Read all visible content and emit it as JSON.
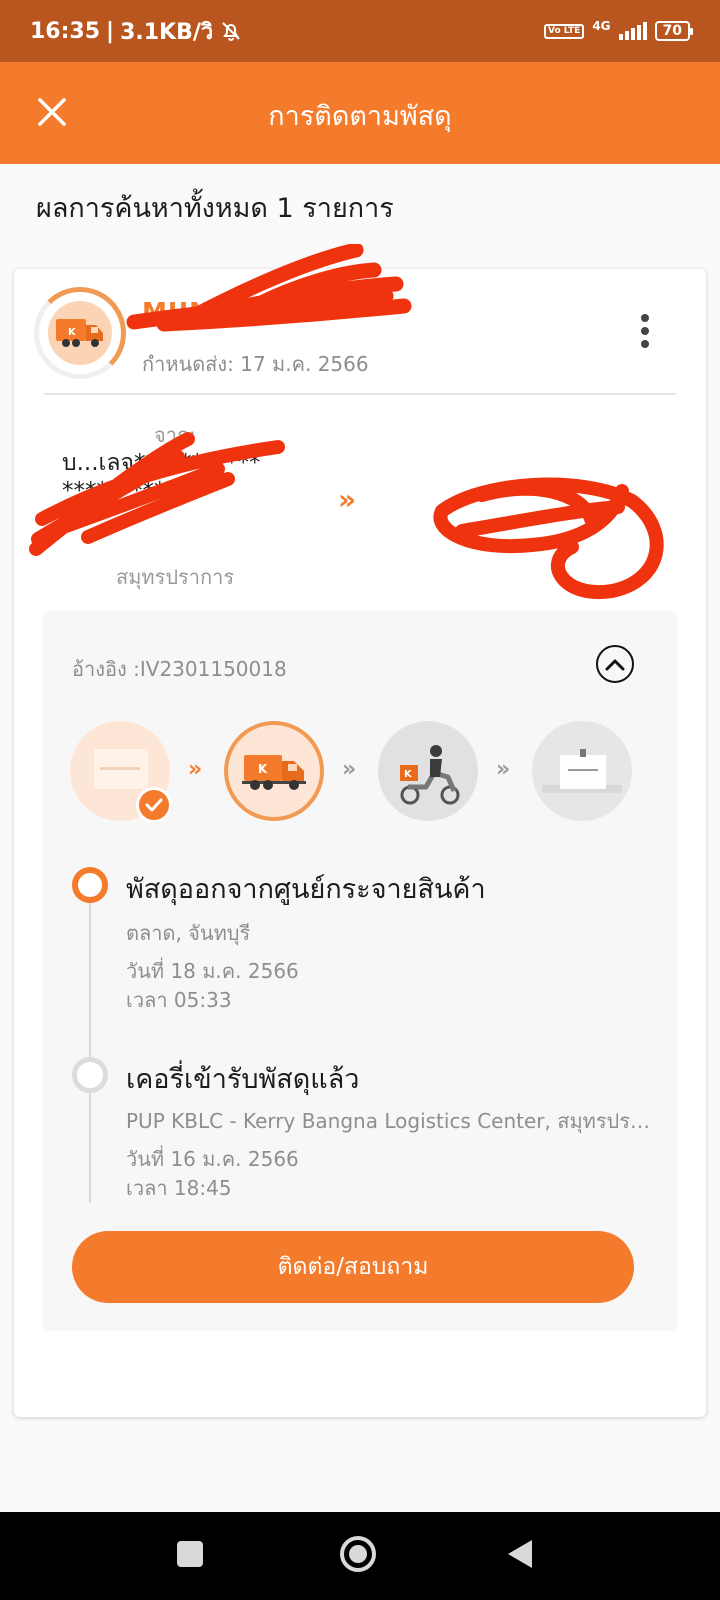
{
  "status_bar": {
    "time": "16:35",
    "speed": "3.1KB/วิ",
    "network": "4G",
    "volte": "Vo LTE",
    "battery": "70"
  },
  "app_bar": {
    "title": "การติดตามพัสดุ",
    "close_icon": "close-icon"
  },
  "results": {
    "count_text": "ผลการค้นหาทั้งหมด 1 รายการ"
  },
  "shipment": {
    "sender_name": "MUNKO",
    "due_date": "กำหนดส่ง: 17 ม.ค. 2566",
    "from_label": "จาก:",
    "from_name": "บ...เลจ***********\n**********",
    "from_province": "สมุทรปราการ",
    "route_arrow": "»",
    "reference": "อ้างอิง :IV2301150018",
    "status_steps": [
      {
        "icon": "parcel-box-icon",
        "state": "done"
      },
      {
        "icon": "delivery-truck-icon",
        "state": "current"
      },
      {
        "icon": "delivery-scooter-icon",
        "state": "pending"
      },
      {
        "icon": "delivered-box-icon",
        "state": "pending"
      }
    ],
    "step_separator": "»",
    "events": [
      {
        "title": "พัสดุออกจากศูนย์กระจายสินค้า",
        "location": "ตลาด, จันทบุรี",
        "date": "วันที่ 18 ม.ค. 2566",
        "time": "เวลา 05:33"
      },
      {
        "title": "เคอรี่เข้ารับพัสดุแล้ว",
        "location": "PUP KBLC - Kerry Bangna Logistics Center, สมุทรปราการ",
        "date": "วันที่ 16 ม.ค. 2566",
        "time": "เวลา 18:45"
      }
    ],
    "contact_button": "ติดต่อ/สอบถาม"
  },
  "colors": {
    "status_bar": "#b9561f",
    "brand_orange": "#f47b2c",
    "redaction_red": "#f0330f"
  }
}
